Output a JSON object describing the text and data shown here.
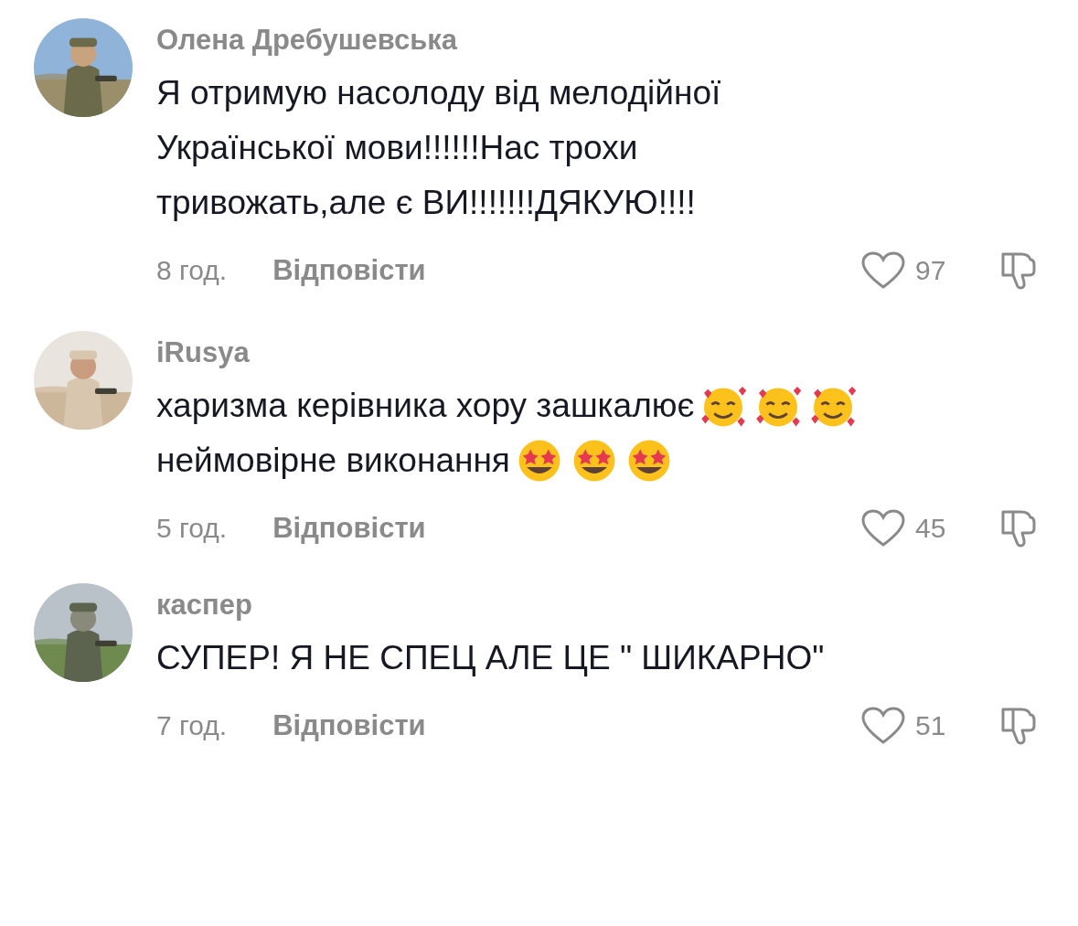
{
  "comments": [
    {
      "author": "Олена Дребушевська",
      "avatar": {
        "kind": "picture"
      },
      "lines": [
        {
          "text": "Я отримую насолоду від мелодійної\nУкраїнської мови!!!!!!Нас трохи\nтривожать,але є ВИ!!!!!!!ДЯКУЮ!!!!"
        }
      ],
      "time": "8 год.",
      "reply": "Відповісти",
      "likes": "97"
    },
    {
      "author": "iRusya",
      "avatar": {
        "kind": "picture"
      },
      "lines": [
        {
          "text": "харизма керівника хору зашкалює",
          "emojis": [
            {
              "kind": "hearts"
            },
            {
              "kind": "hearts"
            },
            {
              "kind": "hearts"
            }
          ]
        },
        {
          "text": "неймовірне виконання",
          "emojis": [
            {
              "kind": "star-eyes"
            },
            {
              "kind": "star-eyes"
            },
            {
              "kind": "star-eyes"
            }
          ]
        }
      ],
      "time": "5 год.",
      "reply": "Відповісти",
      "likes": "45"
    },
    {
      "author": "каспер",
      "avatar": {
        "kind": "picture"
      },
      "lines": [
        {
          "text": "СУПЕР! Я НЕ СПЕЦ АЛЕ ЦЕ \" ШИКАРНО\""
        }
      ],
      "time": "7 год.",
      "reply": "Відповісти",
      "likes": "51"
    }
  ]
}
